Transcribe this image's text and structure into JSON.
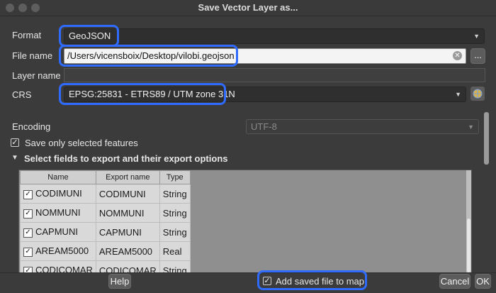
{
  "window": {
    "title": "Save Vector Layer as..."
  },
  "format": {
    "label": "Format",
    "value": "GeoJSON"
  },
  "file_name": {
    "label": "File name",
    "value": "/Users/vicensboix/Desktop/vilobi.geojson",
    "browse": "..."
  },
  "layer_name": {
    "label": "Layer name",
    "value": ""
  },
  "crs": {
    "label": "CRS",
    "value": "EPSG:25831 - ETRS89 / UTM zone 31N"
  },
  "encoding": {
    "label": "Encoding",
    "value": "UTF-8"
  },
  "save_selected": {
    "label": "Save only selected features",
    "checked": true
  },
  "fields_section": {
    "label": "Select fields to export and their export options"
  },
  "table": {
    "headers": [
      "Name",
      "Export name",
      "Type"
    ],
    "rows": [
      {
        "name": "CODIMUNI",
        "export": "CODIMUNI",
        "type": "String"
      },
      {
        "name": "NOMMUNI",
        "export": "NOMMUNI",
        "type": "String"
      },
      {
        "name": "CAPMUNI",
        "export": "CAPMUNI",
        "type": "String"
      },
      {
        "name": "AREAM5000",
        "export": "AREAM5000",
        "type": "Real"
      },
      {
        "name": "CODICOMAR",
        "export": "CODICOMAR",
        "type": "String"
      }
    ]
  },
  "footer": {
    "help": "Help",
    "add_to_map": "Add saved file to map",
    "cancel": "Cancel",
    "ok": "OK"
  },
  "colors": {
    "highlight": "#2f6bff",
    "background": "#3b3b3b"
  }
}
